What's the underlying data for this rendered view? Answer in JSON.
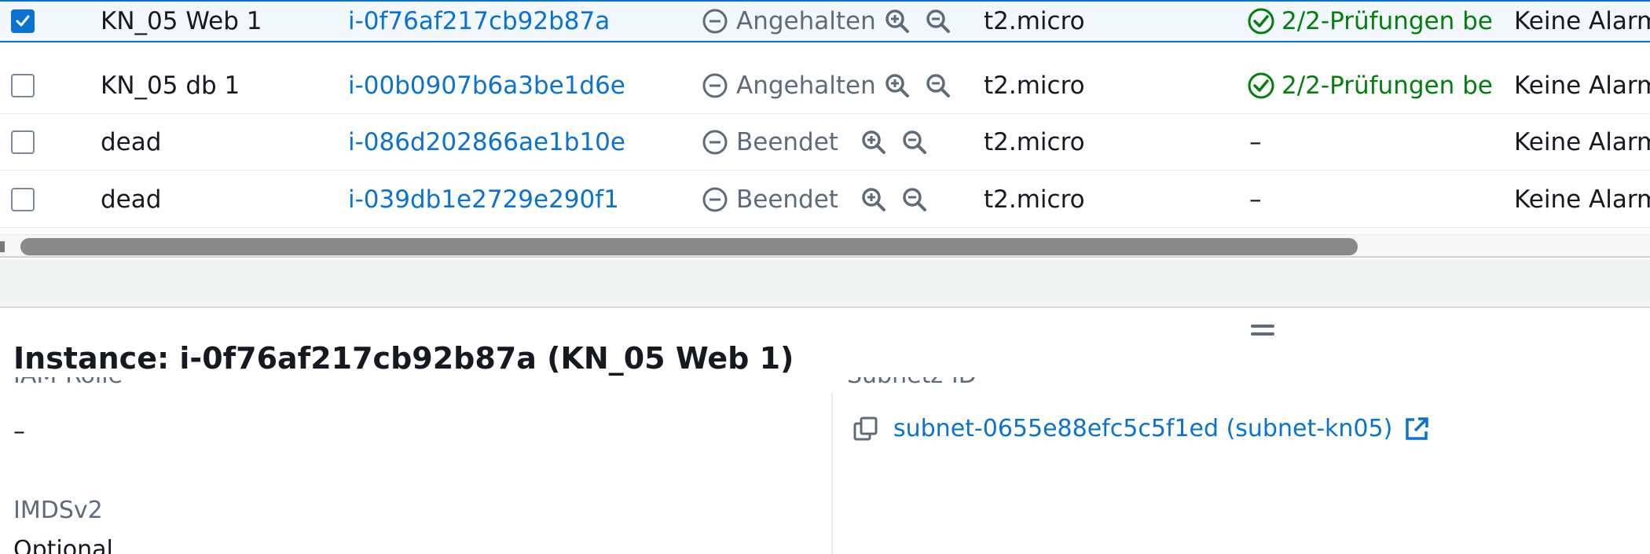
{
  "instances_table": {
    "rows": [
      {
        "selected": true,
        "name": "KN_05 Web 1",
        "instance_id": "i-0f76af217cb92b87a",
        "state": "Angehalten",
        "instance_type": "t2.micro",
        "status_check": "2/2-Prüfungen be",
        "alarm_status": "Keine Alarm"
      },
      {
        "selected": false,
        "name": "KN_05 db 1",
        "instance_id": "i-00b0907b6a3be1d6e",
        "state": "Angehalten",
        "instance_type": "t2.micro",
        "status_check": "2/2-Prüfungen be",
        "alarm_status": "Keine Alarm"
      },
      {
        "selected": false,
        "name": "dead",
        "instance_id": "i-086d202866ae1b10e",
        "state": "Beendet",
        "instance_type": "t2.micro",
        "status_check": "–",
        "alarm_status": "Keine Alarm"
      },
      {
        "selected": false,
        "name": "dead",
        "instance_id": "i-039db1e2729e290f1",
        "state": "Beendet",
        "instance_type": "t2.micro",
        "status_check": "–",
        "alarm_status": "Keine Alarm"
      }
    ]
  },
  "details_panel": {
    "title": "Instance: i-0f76af217cb92b87a (KN_05 Web 1)",
    "left_column": {
      "iam_role_label": "IAM-Rolle",
      "iam_role_value": "–",
      "imdsv2_label": "IMDSv2",
      "imdsv2_value": "Optional"
    },
    "right_column": {
      "subnet_label": "Subnetz-ID",
      "subnet_value": "subnet-0655e88efc5c5f1ed (subnet-kn05)"
    }
  },
  "colors": {
    "link": "#0972d3",
    "success": "#037f0c",
    "muted": "#5f6b7a",
    "selected_border": "#0972d3"
  }
}
